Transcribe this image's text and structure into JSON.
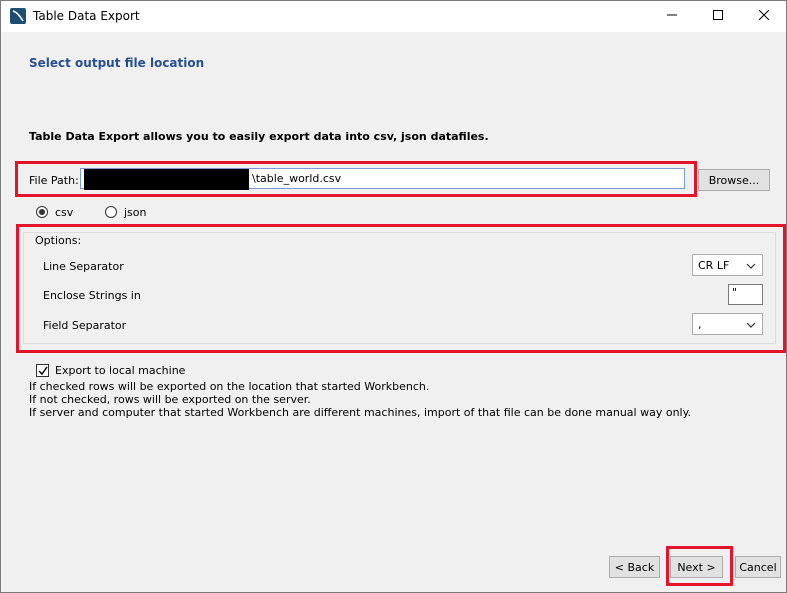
{
  "window": {
    "title": "Table Data Export"
  },
  "page": {
    "heading": "Select output file location",
    "intro": "Table Data Export allows you to easily export data into csv, json datafiles."
  },
  "file_path": {
    "label": "File Path:",
    "value": "\\table_world.csv",
    "browse_label": "Browse..."
  },
  "format": {
    "csv_label": "csv",
    "json_label": "json",
    "selected": "csv"
  },
  "options": {
    "group_label": "Options:",
    "line_separator_label": "Line Separator",
    "line_separator_value": "CR LF",
    "enclose_label": "Enclose Strings in",
    "enclose_value": "\"",
    "field_separator_label": "Field Separator",
    "field_separator_value": ","
  },
  "export_local": {
    "label": "Export to local machine",
    "checked": true,
    "note1": "If checked rows will be exported on the location that started Workbench.",
    "note2": "If not checked, rows will be exported on the server.",
    "note3": "If server and computer that started Workbench are different machines, import of that file can be done manual way only."
  },
  "footer": {
    "back_label": "< Back",
    "next_label": "Next >",
    "cancel_label": "Cancel"
  },
  "colors": {
    "heading": "#2a4f8e",
    "highlight": "#e4152a",
    "background": "#f0f0f0"
  },
  "icons": [
    "workbench-app-icon",
    "minimize-icon",
    "maximize-icon",
    "close-icon",
    "chevron-down-icon",
    "checkmark-icon"
  ]
}
